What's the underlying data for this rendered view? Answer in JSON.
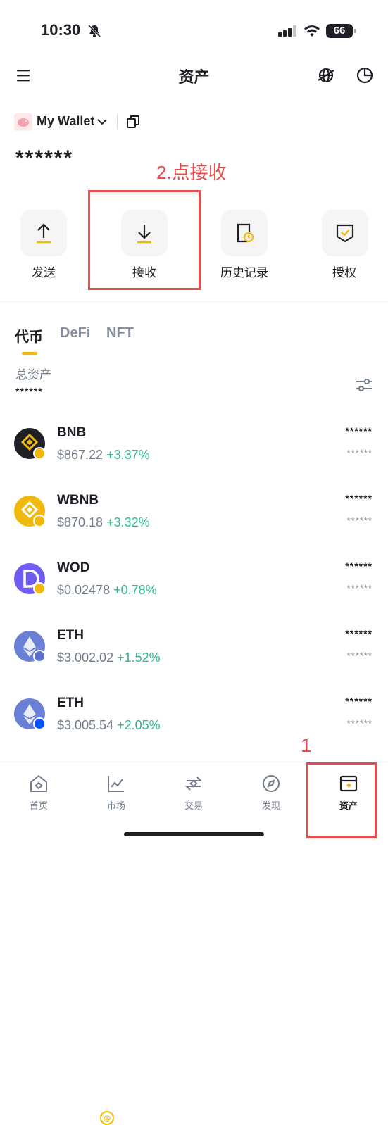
{
  "status": {
    "time": "10:30",
    "battery": "66"
  },
  "header": {
    "title": "资产"
  },
  "wallet": {
    "name": "My Wallet",
    "balance": "******"
  },
  "annotations": {
    "step2": "2.点接收",
    "step1": "1"
  },
  "actions": [
    {
      "label": "发送",
      "icon": "upload-arrow-icon"
    },
    {
      "label": "接收",
      "icon": "download-arrow-icon"
    },
    {
      "label": "历史记录",
      "icon": "history-clock-icon"
    },
    {
      "label": "授权",
      "icon": "shield-check-icon"
    }
  ],
  "tabs": [
    {
      "label": "代币",
      "active": true
    },
    {
      "label": "DeFi",
      "active": false
    },
    {
      "label": "NFT",
      "active": false
    }
  ],
  "total": {
    "label": "总资产",
    "value": "******"
  },
  "tokens": [
    {
      "name": "BNB",
      "price": "$867.22",
      "change": "+3.37%",
      "amount": "******",
      "usd": "******",
      "color": "#1e2026"
    },
    {
      "name": "WBNB",
      "price": "$870.18",
      "change": "+3.32%",
      "amount": "******",
      "usd": "******",
      "color": "#f0b90b"
    },
    {
      "name": "WOD",
      "price": "$0.02478",
      "change": "+0.78%",
      "amount": "******",
      "usd": "******",
      "color": "#6f5cf2"
    },
    {
      "name": "ETH",
      "price": "$3,002.02",
      "change": "+1.52%",
      "amount": "******",
      "usd": "******",
      "color": "#6b7fd6"
    },
    {
      "name": "ETH",
      "price": "$3,005.54",
      "change": "+2.05%",
      "amount": "******",
      "usd": "******",
      "color": "#6b7fd6"
    }
  ],
  "nav": [
    {
      "label": "首页",
      "icon": "home-icon",
      "active": false
    },
    {
      "label": "市场",
      "icon": "chart-icon",
      "active": false
    },
    {
      "label": "交易",
      "icon": "swap-icon",
      "active": false
    },
    {
      "label": "发现",
      "icon": "compass-icon",
      "active": false
    },
    {
      "label": "资产",
      "icon": "wallet-icon",
      "active": true
    }
  ]
}
